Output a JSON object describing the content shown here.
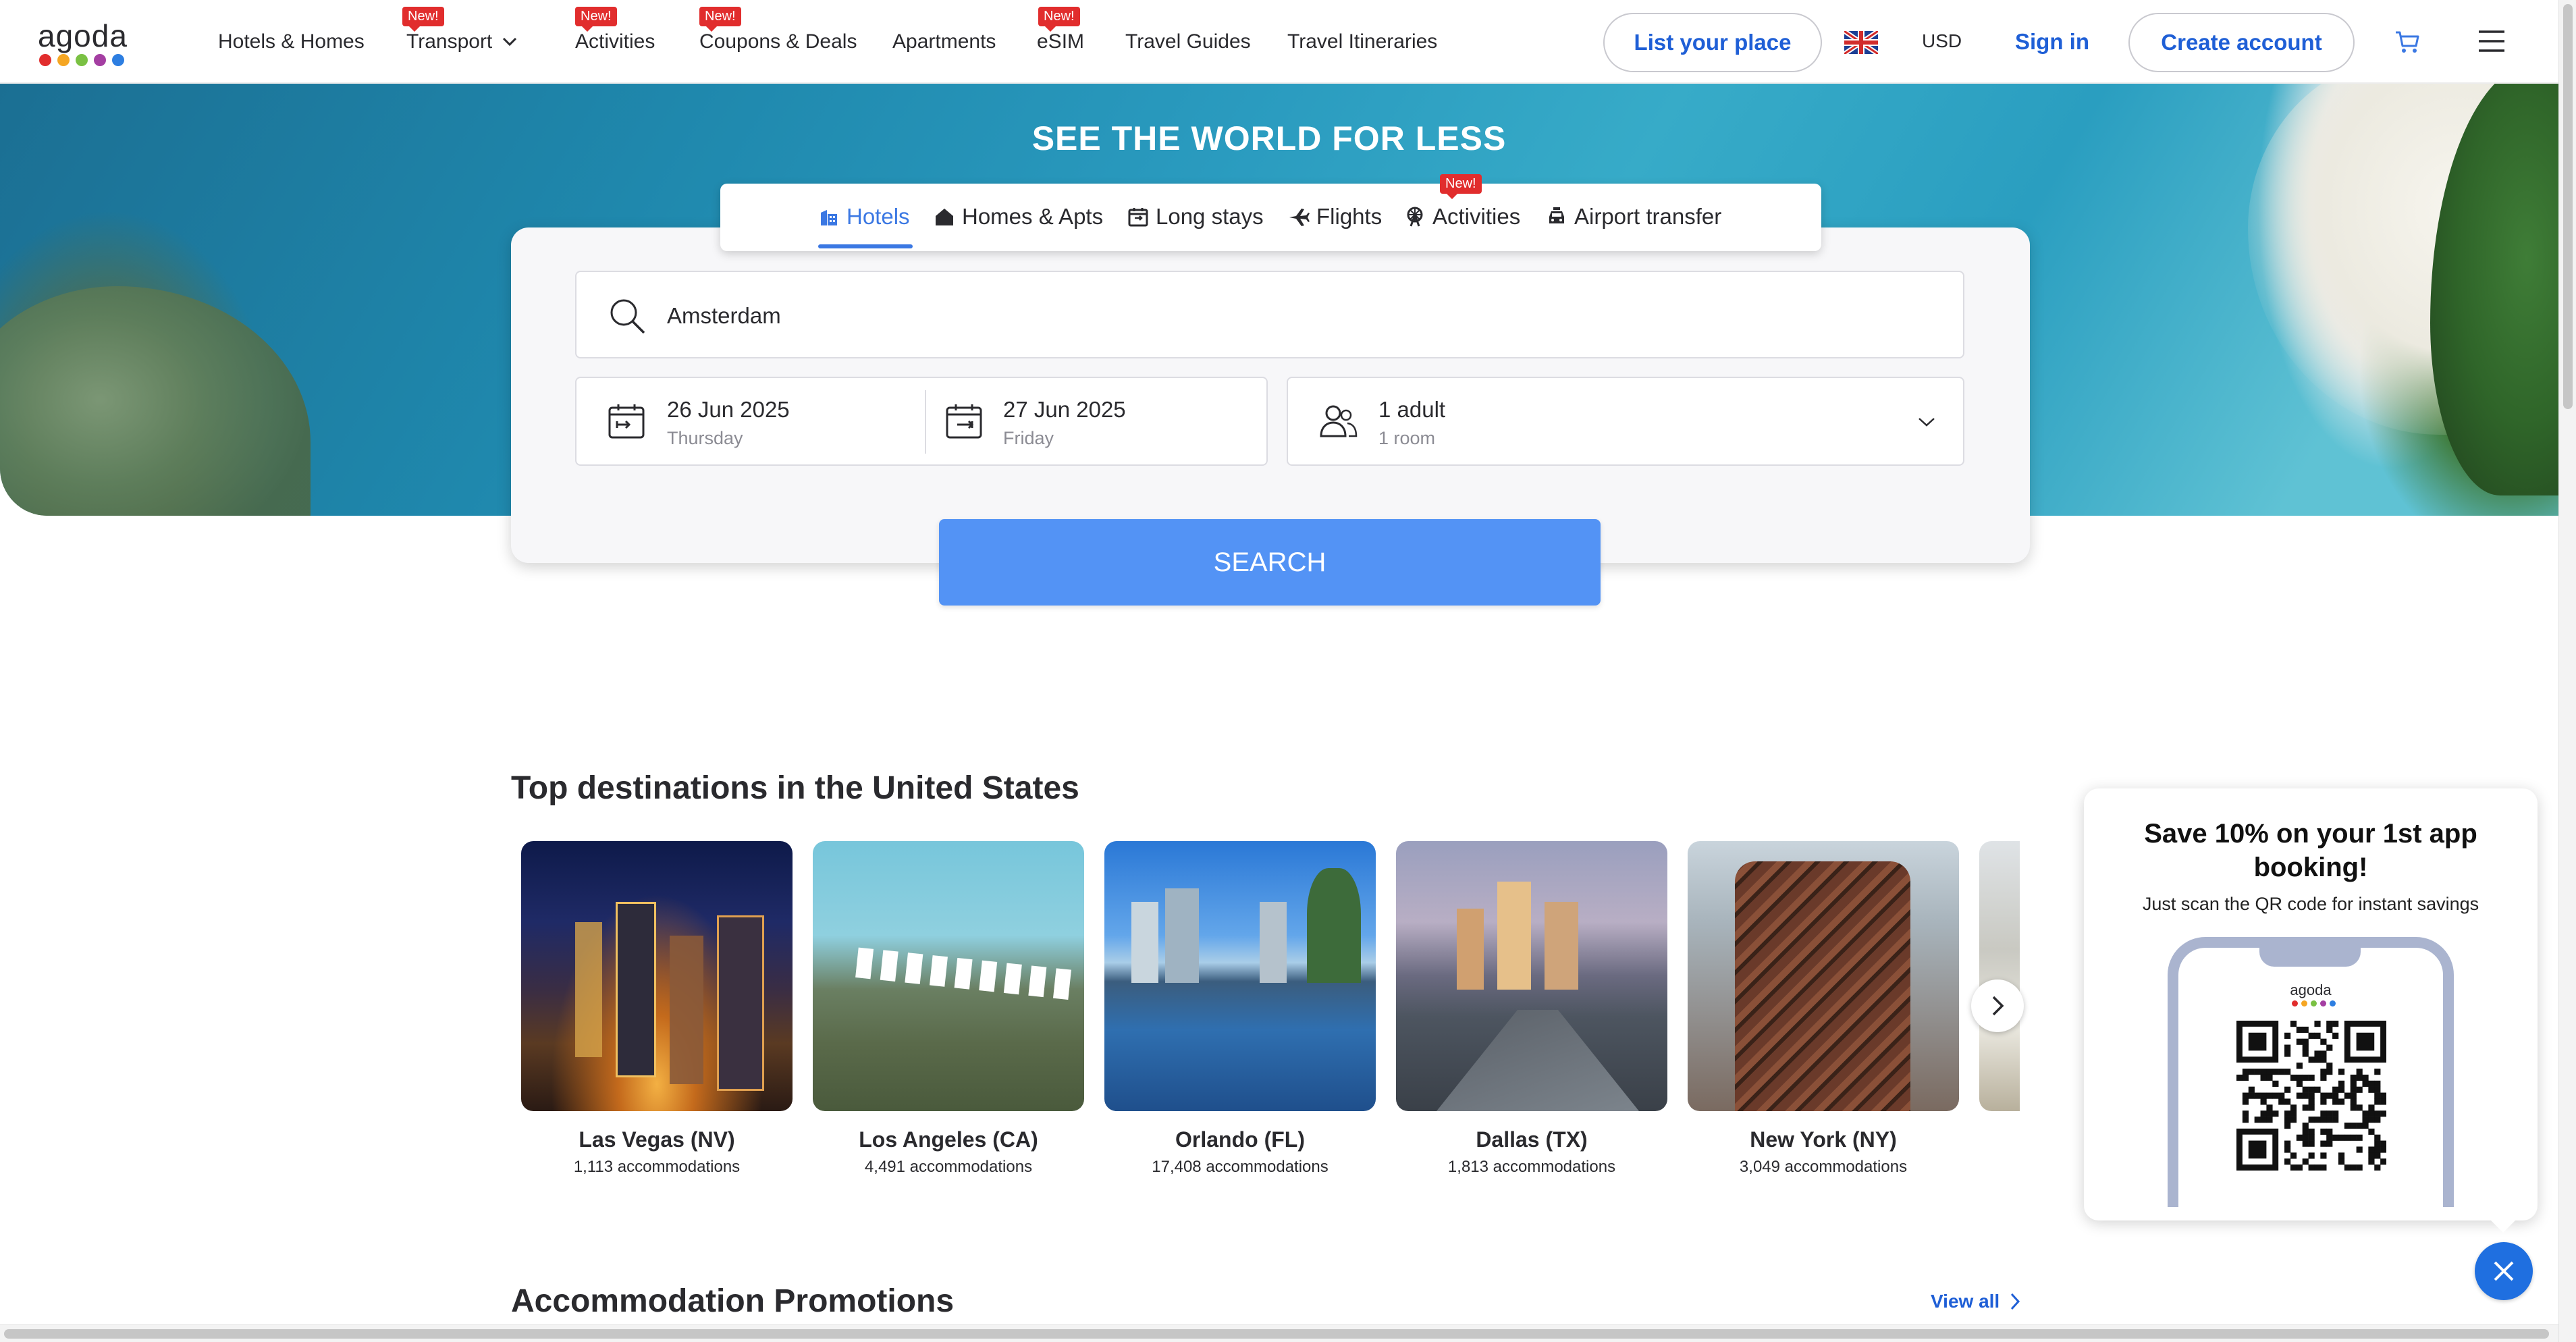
{
  "brand": {
    "logo_text": "agoda",
    "dot_colors": [
      "#e12d2d",
      "#f5a623",
      "#7ac143",
      "#a43ea2",
      "#2d7ee1"
    ]
  },
  "nav": {
    "items": [
      {
        "label": "Hotels & Homes",
        "badge": ""
      },
      {
        "label": "Transport",
        "badge": "New!"
      },
      {
        "label": "Activities",
        "badge": "New!"
      },
      {
        "label": "Coupons & Deals",
        "badge": "New!"
      },
      {
        "label": "Apartments",
        "badge": ""
      },
      {
        "label": "eSIM",
        "badge": "New!"
      },
      {
        "label": "Travel Guides",
        "badge": ""
      },
      {
        "label": "Travel Itineraries",
        "badge": ""
      }
    ],
    "list_place": "List your place",
    "currency": "USD",
    "sign_in": "Sign in",
    "create_account": "Create account",
    "language_flag": "uk-flag-icon"
  },
  "hero": {
    "title": "SEE THE WORLD FOR LESS"
  },
  "search": {
    "tabs": [
      {
        "label": "Hotels",
        "icon": "hotel-icon",
        "active": true,
        "badge": ""
      },
      {
        "label": "Homes & Apts",
        "icon": "home-icon",
        "active": false,
        "badge": ""
      },
      {
        "label": "Long stays",
        "icon": "calendar-icon",
        "active": false,
        "badge": ""
      },
      {
        "label": "Flights",
        "icon": "plane-icon",
        "active": false,
        "badge": ""
      },
      {
        "label": "Activities",
        "icon": "ferris-wheel-icon",
        "active": false,
        "badge": "New!"
      },
      {
        "label": "Airport transfer",
        "icon": "car-icon",
        "active": false,
        "badge": ""
      }
    ],
    "destination": "Amsterdam",
    "checkin": {
      "date": "26 Jun 2025",
      "day": "Thursday"
    },
    "checkout": {
      "date": "27 Jun 2025",
      "day": "Friday"
    },
    "guests": {
      "occupancy": "1 adult",
      "rooms": "1 room"
    },
    "button": "SEARCH"
  },
  "destinations": {
    "title": "Top destinations in the United States",
    "items": [
      {
        "name": "Las Vegas (NV)",
        "count": "1,113 accommodations"
      },
      {
        "name": "Los Angeles (CA)",
        "count": "4,491 accommodations"
      },
      {
        "name": "Orlando (FL)",
        "count": "17,408 accommodations"
      },
      {
        "name": "Dallas (TX)",
        "count": "1,813 accommodations"
      },
      {
        "name": "New York (NY)",
        "count": "3,049 accommodations"
      }
    ]
  },
  "promotions": {
    "title": "Accommodation Promotions",
    "view_all": "View all"
  },
  "app_promo": {
    "title": "Save 10% on your 1st app booking!",
    "subtitle": "Just scan the QR code for instant savings",
    "phone_logo": "agoda"
  },
  "colors": {
    "accent": "#3b78e3",
    "search_button": "#5393f5",
    "badge": "#e12d2d"
  }
}
